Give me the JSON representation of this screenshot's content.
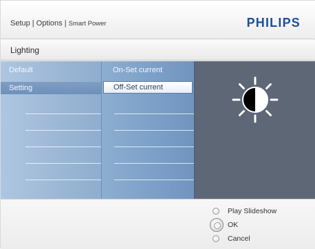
{
  "header": {
    "breadcrumb": {
      "part1": "Setup",
      "sep1": " | ",
      "part2": "Options",
      "sep2": " | ",
      "part3": "Smart Power"
    },
    "brand": "PHILIPS"
  },
  "title": "Lighting",
  "panels": {
    "left": {
      "items": [
        {
          "label": "Default",
          "selected": false
        },
        {
          "label": "Setting",
          "selected": true
        }
      ]
    },
    "middle": {
      "items": [
        {
          "label": "On-Set current",
          "selected": false
        },
        {
          "label": "Off-Set current",
          "selected": true
        }
      ]
    },
    "preview": {
      "icon": "brightness-half-sun-icon"
    }
  },
  "footer": {
    "options": [
      {
        "label": "Play Slideshow",
        "style": "small"
      },
      {
        "label": "OK",
        "style": "large"
      },
      {
        "label": "Cancel",
        "style": "small"
      }
    ]
  },
  "colors": {
    "brand_blue": "#1b4f9a",
    "left_panel": "#9db8d6",
    "middle_panel": "#7b9fc7",
    "preview_panel": "#5e6776"
  }
}
